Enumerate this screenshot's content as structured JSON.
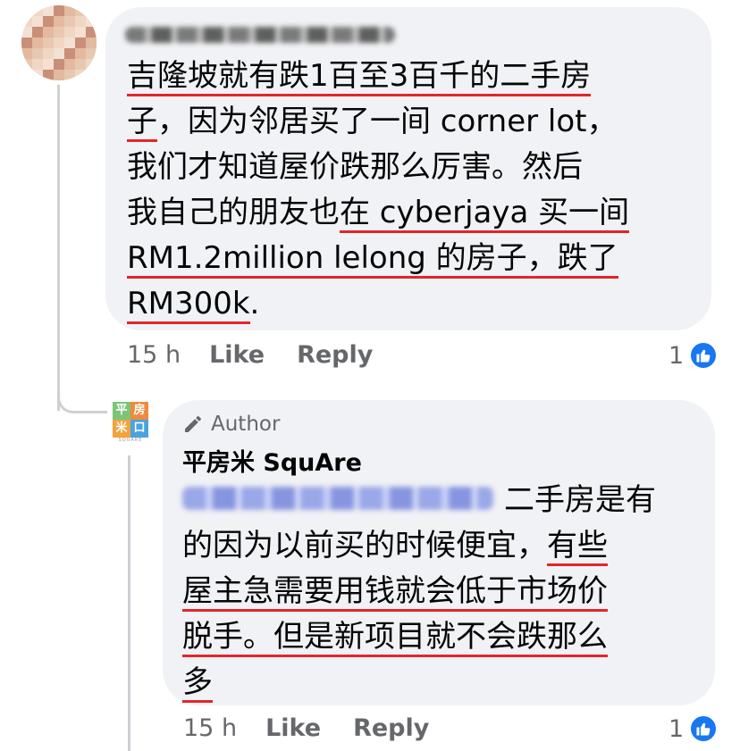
{
  "comment1": {
    "author_name": "Jennifer Tan Yi Siew",
    "lines": [
      [
        {
          "t": "吉隆坡就有跌1百至3百千的二手房",
          "u": true
        }
      ],
      [
        {
          "t": "子",
          "u": true
        },
        {
          "t": "，因为邻居买了一间 corner lot，",
          "u": false
        }
      ],
      [
        {
          "t": "我们才知道屋价跌那么厉害。然后",
          "u": false
        }
      ],
      [
        {
          "t": "我自己的朋友也",
          "u": false
        },
        {
          "t": "在 cyberjaya 买一间",
          "u": true
        }
      ],
      [
        {
          "t": "RM1.2million lelong 的房子，跌了",
          "u": true
        }
      ],
      [
        {
          "t": "RM300k",
          "u": true
        },
        {
          "t": ".",
          "u": false
        }
      ]
    ],
    "time": "15 h",
    "like_label": "Like",
    "reply_label": "Reply",
    "reaction_count": "1",
    "reaction_icon": "thumbs-up-icon"
  },
  "comment2": {
    "author_badge": "Author",
    "author_name": "平房米 SquAre",
    "mention": "Jennifer Tan Yi Siew",
    "lines": [
      [
        {
          "t": "二手房是有",
          "u": false
        }
      ],
      [
        {
          "t": "的因为以前买的时候便宜，",
          "u": false
        },
        {
          "t": "有些",
          "u": true
        }
      ],
      [
        {
          "t": "屋主急需要用钱就会低于市场价",
          "u": true
        }
      ],
      [
        {
          "t": "脱手。但是新项目就不会跌那么",
          "u": true
        }
      ],
      [
        {
          "t": "多",
          "u": true
        }
      ]
    ],
    "time": "15 h",
    "like_label": "Like",
    "reply_label": "Reply",
    "reaction_count": "1",
    "reaction_icon": "thumbs-up-icon"
  },
  "page_avatar": {
    "cells": [
      "平",
      "房",
      "米",
      "口"
    ],
    "tagline": "SQUARE",
    "colors": [
      "#7cc576",
      "#f08a3c",
      "#f4a23a",
      "#4aa3df"
    ]
  },
  "colors": {
    "underline": "#e4252a",
    "bubble": "#f0f2f5",
    "meta": "#65676b",
    "like_blue": "#1877f2"
  }
}
